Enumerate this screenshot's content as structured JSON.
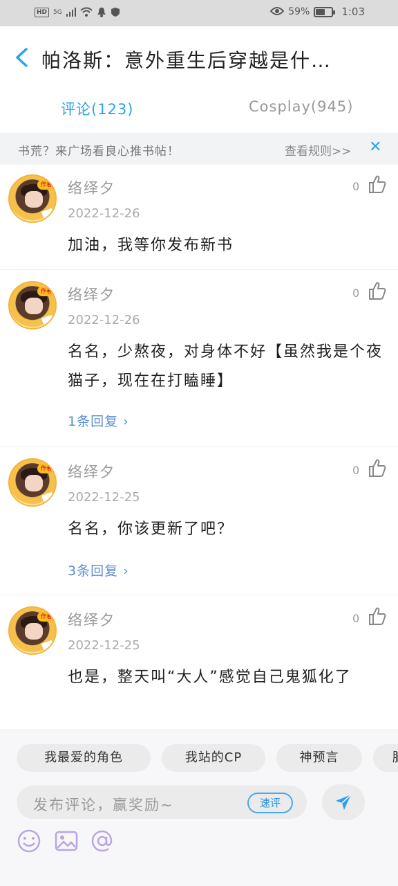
{
  "status_bar": {
    "hd": "HD",
    "signal": "5G",
    "battery_percent": "59%",
    "battery_level": 0.59,
    "time": "1:03"
  },
  "header": {
    "title": "帕洛斯：意外重生后穿越是什…"
  },
  "tabs": [
    {
      "label": "评论(123)",
      "active": true
    },
    {
      "label": "Cosplay(945)",
      "active": false
    }
  ],
  "banner": {
    "text": "书荒？来广场看良心推书帖！",
    "rules": "查看规则>>",
    "close_icon": "close-icon"
  },
  "comments": [
    {
      "author": "络绎夕",
      "badge": "作者",
      "date": "2022-12-26",
      "likes": "0",
      "text": "加油，我等你发布新书",
      "replies": ""
    },
    {
      "author": "络绎夕",
      "badge": "作者",
      "date": "2022-12-26",
      "likes": "0",
      "text": "名名，少熬夜，对身体不好【虽然我是个夜猫子，现在在打瞌睡】",
      "replies": "1条回复 ›"
    },
    {
      "author": "络绎夕",
      "badge": "作者",
      "date": "2022-12-25",
      "likes": "0",
      "text": "名名，你该更新了吧？",
      "replies": "3条回复 ›"
    },
    {
      "author": "络绎夕",
      "badge": "作者",
      "date": "2022-12-25",
      "likes": "0",
      "text": "也是，整天叫“大人”感觉自己鬼狐化了",
      "replies": ""
    }
  ],
  "bottom": {
    "chips": [
      "我最爱的角色",
      "我站的CP",
      "神预言",
      "脑"
    ],
    "input_placeholder": "发布评论，赢奖励~",
    "quick_comment": "速评",
    "icons": [
      "emoji-icon",
      "image-icon",
      "at-icon"
    ]
  },
  "colors": {
    "accent": "#2aa3e8",
    "reply_link": "#5a8ed0",
    "tool_icon": "#b9a5e3"
  }
}
